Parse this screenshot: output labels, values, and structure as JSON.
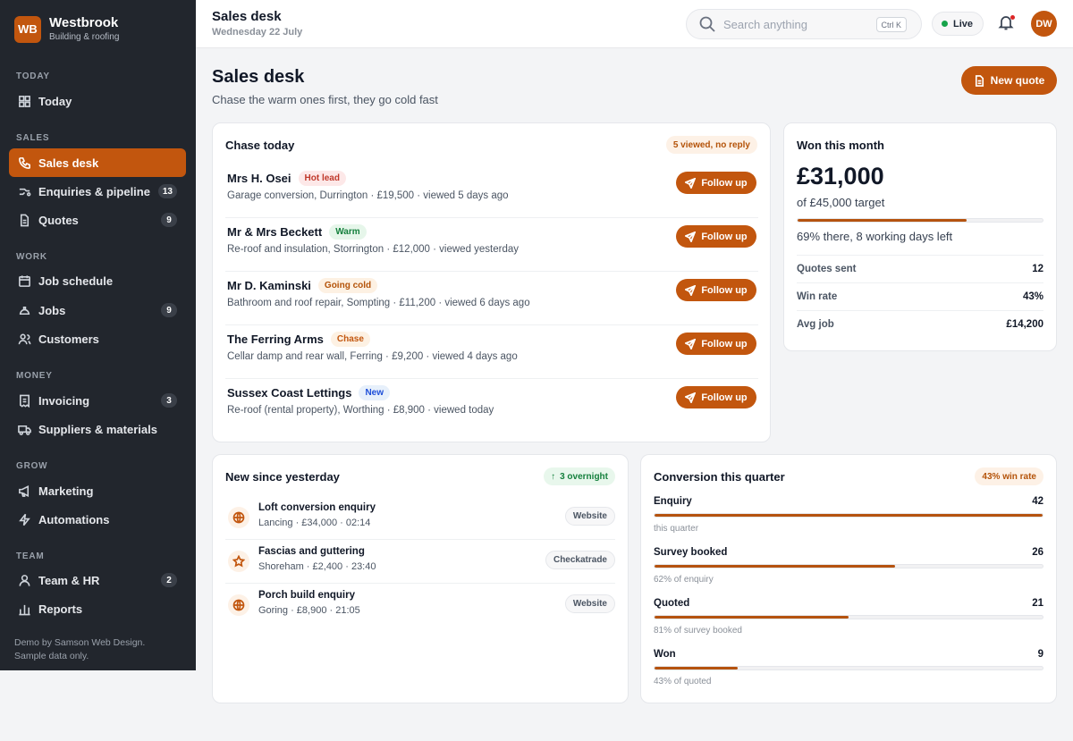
{
  "brand": {
    "logo": "WB",
    "name": "Westbrook",
    "subtitle": "Building & roofing"
  },
  "nav": {
    "sections": [
      "TODAY",
      "SALES",
      "WORK",
      "MONEY",
      "GROW",
      "TEAM"
    ],
    "items": [
      {
        "label": "Today",
        "icon": "grid-icon"
      },
      {
        "label": "Sales desk",
        "icon": "phone-icon",
        "active": true
      },
      {
        "label": "Enquiries & pipeline",
        "icon": "pipeline-icon",
        "badge": "13"
      },
      {
        "label": "Quotes",
        "icon": "document-icon",
        "badge": "9"
      },
      {
        "label": "Job schedule",
        "icon": "calendar-icon"
      },
      {
        "label": "Jobs",
        "icon": "hard-hat-icon",
        "badge": "9"
      },
      {
        "label": "Customers",
        "icon": "users-icon"
      },
      {
        "label": "Invoicing",
        "icon": "receipt-icon",
        "badge": "3"
      },
      {
        "label": "Suppliers & materials",
        "icon": "truck-icon"
      },
      {
        "label": "Marketing",
        "icon": "megaphone-icon"
      },
      {
        "label": "Automations",
        "icon": "bolt-icon"
      },
      {
        "label": "Team & HR",
        "icon": "user-icon",
        "badge": "2"
      },
      {
        "label": "Reports",
        "icon": "bar-chart-icon"
      }
    ],
    "footer": "Demo by Samson Web Design. Sample data only."
  },
  "topbar": {
    "title": "Sales desk",
    "date": "Wednesday 22 July",
    "search_placeholder": "Search anything",
    "search_shortcut": "Ctrl K",
    "live_label": "Live",
    "avatar_initials": "DW"
  },
  "page": {
    "title": "Sales desk",
    "subtitle": "Chase the warm ones first, they go cold fast",
    "new_quote_label": "New quote"
  },
  "chase": {
    "title": "Chase today",
    "badge": "5 viewed, no reply",
    "button_label": "Follow up",
    "rows": [
      {
        "name": "Mrs H. Osei",
        "tag": "Hot lead",
        "detail": "Garage conversion, Durrington · £19,500 · viewed 5 days ago"
      },
      {
        "name": "Mr & Mrs Beckett",
        "tag": "Warm",
        "detail": "Re-roof and insulation, Storrington · £12,000 · viewed yesterday"
      },
      {
        "name": "Mr D. Kaminski",
        "tag": "Going cold",
        "detail": "Bathroom and roof repair, Sompting · £11,200 · viewed 6 days ago"
      },
      {
        "name": "The Ferring Arms",
        "tag": "Chase",
        "detail": "Cellar damp and rear wall, Ferring · £9,200 · viewed 4 days ago"
      },
      {
        "name": "Sussex Coast Lettings",
        "tag": "New",
        "detail": "Re-roof (rental property), Worthing · £8,900 · viewed today"
      }
    ]
  },
  "won": {
    "title": "Won this month",
    "amount": "£31,000",
    "target": "of £45,000 target",
    "progress": 0.69,
    "note": "69% there, 8 working days left",
    "stats": [
      {
        "label": "Quotes sent",
        "value": "12"
      },
      {
        "label": "Win rate",
        "value": "43%"
      },
      {
        "label": "Avg job",
        "value": "£14,200"
      }
    ]
  },
  "new_since": {
    "title": "New since yesterday",
    "badge": "3 overnight",
    "rows": [
      {
        "title": "Loft conversion enquiry",
        "detail": "Lancing · £34,000 · 02:14",
        "source": "Website",
        "icon": "globe-icon"
      },
      {
        "title": "Fascias and guttering",
        "detail": "Shoreham · £2,400 · 23:40",
        "source": "Checkatrade",
        "icon": "star-icon"
      },
      {
        "title": "Porch build enquiry",
        "detail": "Goring · £8,900 · 21:05",
        "source": "Website",
        "icon": "globe-icon"
      }
    ]
  },
  "conversion": {
    "title": "Conversion this quarter",
    "badge": "43% win rate",
    "stages": [
      {
        "label": "Enquiry",
        "value": "42",
        "sub": "this quarter",
        "fraction": 1.0
      },
      {
        "label": "Survey booked",
        "value": "26",
        "sub": "62% of enquiry",
        "fraction": 0.62
      },
      {
        "label": "Quoted",
        "value": "21",
        "sub": "81% of survey booked",
        "fraction": 0.5
      },
      {
        "label": "Won",
        "value": "9",
        "sub": "43% of quoted",
        "fraction": 0.214
      }
    ]
  },
  "colors": {
    "accent": "#c2560e",
    "sidebar": "#22262d"
  }
}
